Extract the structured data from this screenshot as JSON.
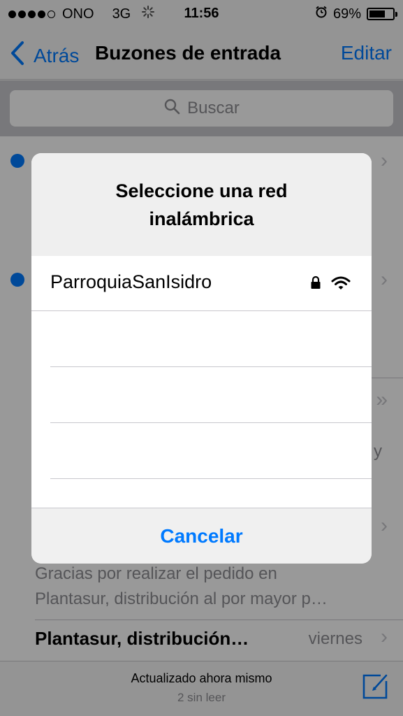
{
  "status": {
    "carrier": "ONO",
    "network": "3G",
    "time": "11:56",
    "battery": "69%",
    "battery_level": 0.69
  },
  "nav": {
    "back_label": "Atrás",
    "title": "Buzones de entrada",
    "edit_label": "Editar"
  },
  "search": {
    "placeholder": "Buscar"
  },
  "mail": {
    "item3_preview_partial": "y",
    "item4_preview_line1": "Gracias por realizar el pedido en",
    "item4_preview_line2": "Plantasur, distribución al por mayor p…",
    "item5_sender": "Plantasur, distribución…",
    "item5_date": "viernes"
  },
  "toolbar": {
    "status": "Actualizado ahora mismo",
    "unread": "2 sin leer"
  },
  "alert": {
    "title": "Seleccione una red inalámbrica",
    "networks": [
      {
        "name": "ParroquiaSanIsidro",
        "secured": true
      }
    ],
    "cancel_label": "Cancelar"
  },
  "colors": {
    "accent": "#007aff"
  }
}
